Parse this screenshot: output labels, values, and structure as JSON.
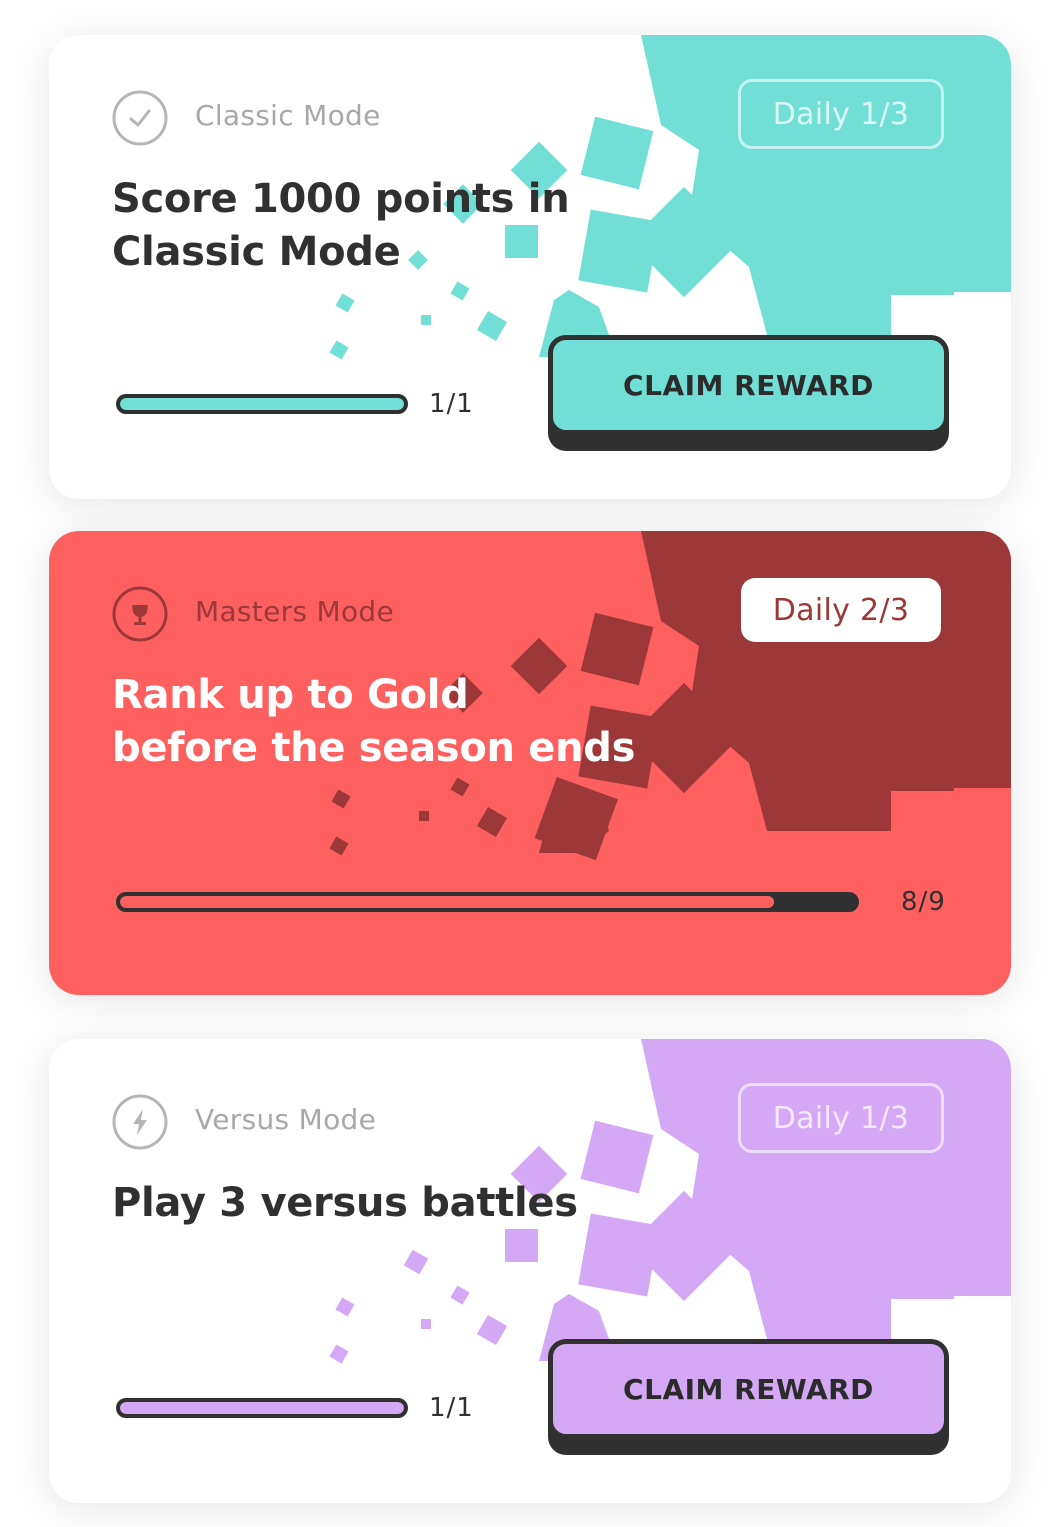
{
  "colors": {
    "classic_accent": "#72dfd6",
    "masters_bg": "#fe6060",
    "masters_dark": "#9c3838",
    "versus_accent": "#d4a8f4",
    "ink": "#303030"
  },
  "cards": [
    {
      "mode_icon": "check-circle-icon",
      "mode_label": "Classic Mode",
      "badge": "Daily 1/3",
      "title_line1": "Score 1000 points in",
      "title_line2": "Classic Mode",
      "progress": {
        "current": 1,
        "total": 1,
        "text": "1/1",
        "fraction": 1.0
      },
      "claim_label": "CLAIM REWARD"
    },
    {
      "mode_icon": "trophy-circle-icon",
      "mode_label": "Masters Mode",
      "badge": "Daily 2/3",
      "title_line1": "Rank up to Gold",
      "title_line2": "before the season ends",
      "progress": {
        "current": 8,
        "total": 9,
        "text": "8/9",
        "fraction": 0.89
      }
    },
    {
      "mode_icon": "lightning-circle-icon",
      "mode_label": "Versus Mode",
      "badge": "Daily 1/3",
      "title_line1": "Play 3 versus battles",
      "title_line2": "",
      "progress": {
        "current": 1,
        "total": 1,
        "text": "1/1",
        "fraction": 1.0
      },
      "claim_label": "CLAIM REWARD"
    }
  ]
}
